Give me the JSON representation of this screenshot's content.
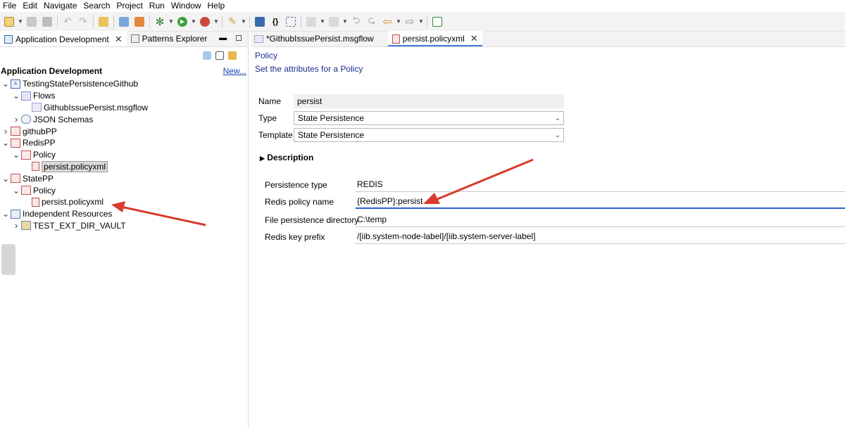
{
  "menu": [
    "File",
    "Edit",
    "Navigate",
    "Search",
    "Project",
    "Run",
    "Window",
    "Help"
  ],
  "left_tabs": [
    {
      "label": "Application Development",
      "icon": "app-dev-icon"
    },
    {
      "label": "Patterns Explorer",
      "icon": "patterns-icon"
    }
  ],
  "section": {
    "title": "Application Development",
    "new_link": "New..."
  },
  "tree": [
    {
      "level": 0,
      "toggle": "v",
      "icon": "application-icon",
      "label": "TestingStatePersistenceGithub"
    },
    {
      "level": 1,
      "toggle": "v",
      "icon": "flows-folder-icon",
      "label": "Flows"
    },
    {
      "level": 2,
      "toggle": "",
      "icon": "msgflow-icon",
      "label": "GithubIssuePersist.msgflow"
    },
    {
      "level": 1,
      "toggle": ">",
      "icon": "json-schema-icon",
      "label": "JSON Schemas"
    },
    {
      "level": 0,
      "toggle": ">",
      "icon": "policy-project-icon",
      "label": "githubPP"
    },
    {
      "level": 0,
      "toggle": "v",
      "icon": "policy-project-icon",
      "label": "RedisPP"
    },
    {
      "level": 1,
      "toggle": "v",
      "icon": "policy-folder-icon",
      "label": "Policy"
    },
    {
      "level": 2,
      "toggle": "",
      "icon": "policy-file-icon",
      "label": "persist.policyxml",
      "selected": true
    },
    {
      "level": 0,
      "toggle": "v",
      "icon": "policy-project-icon",
      "label": "StatePP"
    },
    {
      "level": 1,
      "toggle": "v",
      "icon": "policy-folder-icon",
      "label": "Policy"
    },
    {
      "level": 2,
      "toggle": "",
      "icon": "policy-file-icon",
      "label": "persist.policyxml"
    },
    {
      "level": 0,
      "toggle": "v",
      "icon": "resources-icon",
      "label": "Independent Resources"
    },
    {
      "level": 1,
      "toggle": ">",
      "icon": "open-folder-icon",
      "label": "TEST_EXT_DIR_VAULT"
    }
  ],
  "editor_tabs": [
    {
      "label": "*GithubIssuePersist.msgflow",
      "icon": "msgflow-icon",
      "active": false
    },
    {
      "label": "persist.policyxml",
      "icon": "policy-file-icon",
      "active": true
    }
  ],
  "editor": {
    "title": "Policy",
    "subtitle": "Set the attributes for a Policy",
    "name_label": "Name",
    "name_value": "persist",
    "type_label": "Type",
    "type_value": "State Persistence",
    "template_label": "Template",
    "template_value": "State Persistence",
    "description_label": "Description"
  },
  "properties": [
    {
      "label": "Persistence type",
      "value": "REDIS"
    },
    {
      "label": "Redis policy name",
      "value": "{RedisPP}:persist"
    },
    {
      "label": "File persistence directory",
      "value": "C:\\temp"
    },
    {
      "label": "Redis key prefix",
      "value": "/[iib.system-node-label]/[iib.system-server-label]"
    }
  ],
  "colors": {
    "annotation_arrow": "#d93a2b",
    "focus_underline": "#2b5fc9",
    "link": "#1a3fb0"
  }
}
